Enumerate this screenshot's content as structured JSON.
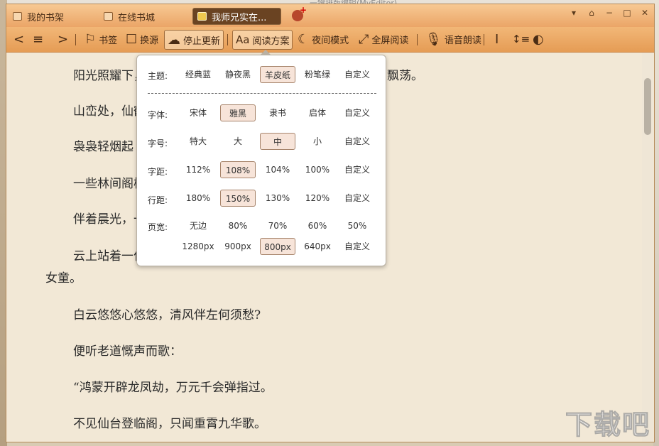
{
  "background": {
    "top_text": "一键排版编辑(MyEditor)"
  },
  "tabs": [
    {
      "label": "我的书架"
    },
    {
      "label": "在线书城"
    },
    {
      "label": "我师兄实在..."
    }
  ],
  "window_controls": {
    "menu": "▾",
    "skin": "⌂",
    "minimize": "−",
    "maximize": "□",
    "close": "✕"
  },
  "toolbar": {
    "back": "<",
    "toc": "≡",
    "forward": ">",
    "bookmark": "书签",
    "change_source": "换源",
    "stop_update": "停止更新",
    "reading_scheme": "阅读方案",
    "night_mode": "夜间模式",
    "fullscreen": "全屏阅读",
    "tts": "语音朗读",
    "cursor_icon": "I",
    "spacing_icon": "↕≡",
    "contrast_icon": "◐"
  },
  "paragraphs": [
    "阳光照耀下，群山之中有一股股肉眼可见的灵气在阵内来回飘荡。",
    "山峦处，仙鹤惊飞，有身影惊鸿一现。",
    "袅袅轻烟起",
    "一些林间阁楼，腾飞漫舞，凑成了一幅仙山景图。",
    "伴着晨光，一座大阵附近。",
    "云上站着一位老道，他带着一名八九岁模样的灵秀",
    "女童。",
    "白云悠悠心悠悠，清风伴左何须愁?",
    "便听老道慨声而歌：",
    "“鸿蒙开辟龙凤劫，万元千会弹指过。",
    "不见仙台登临阁，只闻重霄九华歌。"
  ],
  "settings": {
    "theme": {
      "label": "主题:",
      "options": [
        "经典蓝",
        "静夜黑",
        "羊皮纸",
        "粉笔绿",
        "自定义"
      ],
      "selected": "羊皮纸"
    },
    "font": {
      "label": "字体:",
      "options": [
        "宋体",
        "雅黑",
        "隶书",
        "启体",
        "自定义"
      ],
      "selected": "雅黑"
    },
    "size": {
      "label": "字号:",
      "options": [
        "特大",
        "大",
        "中",
        "小",
        "自定义"
      ],
      "selected": "中"
    },
    "letter_spacing": {
      "label": "字距:",
      "options": [
        "112%",
        "108%",
        "104%",
        "100%",
        "自定义"
      ],
      "selected": "108%"
    },
    "line_spacing": {
      "label": "行距:",
      "options": [
        "180%",
        "150%",
        "130%",
        "120%",
        "自定义"
      ],
      "selected": "150%"
    },
    "page_width": {
      "label": "页宽:",
      "options": [
        "无边",
        "80%",
        "70%",
        "60%",
        "50%"
      ],
      "selected": ""
    },
    "page_width_px": {
      "options": [
        "1280px",
        "900px",
        "800px",
        "640px",
        "自定义"
      ],
      "selected": "800px"
    }
  },
  "watermark": "下载吧"
}
